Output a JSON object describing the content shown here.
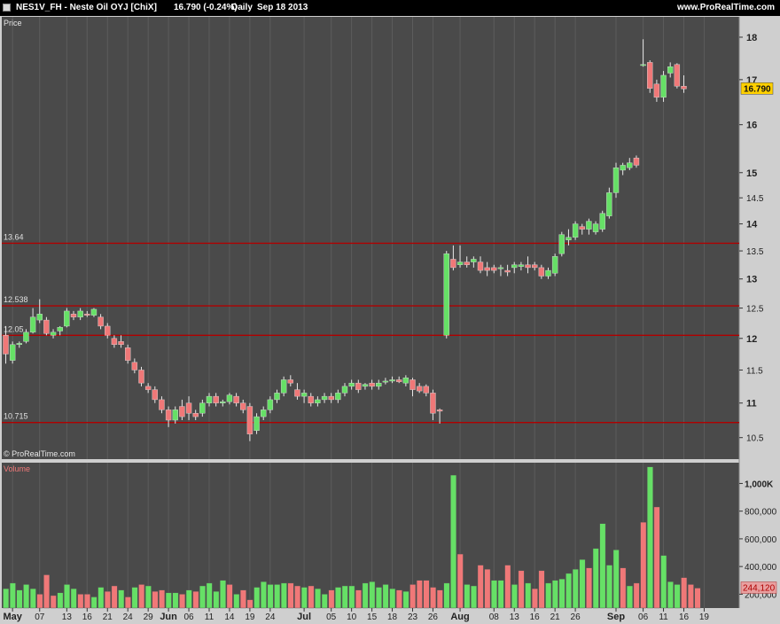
{
  "header": {
    "symbol": "NES1V_FH - Neste Oil OYJ [ChiX]",
    "quote": "16.790 (-0.24%)",
    "period": "Daily",
    "date": "Sep 18 2013",
    "site": "www.ProRealTime.com"
  },
  "colors": {
    "up": "#66e066",
    "down": "#f07878",
    "panel": "#4a4a4a",
    "level_line": "#b00000",
    "last_price_bg": "#ffd000"
  },
  "chart_data": [
    {
      "type": "candlestick",
      "title": "Price",
      "watermark": "© ProRealTime.com",
      "y_scale": "log",
      "ylim": [
        10.2,
        18.5
      ],
      "y_ticks": [
        10.5,
        11,
        11.5,
        12,
        12.5,
        13,
        13.5,
        14,
        14.5,
        15,
        16,
        17,
        18
      ],
      "y_tick_labels": [
        "10.5",
        "11",
        "11.5",
        "12",
        "12.5",
        "13",
        "13.5",
        "14",
        "14.5",
        "15",
        "16",
        "17",
        "18"
      ],
      "last_price_label": "16.790",
      "last_price": 16.79,
      "levels": [
        {
          "value": 13.64,
          "label": "13.64"
        },
        {
          "value": 12.538,
          "label": "12.538"
        },
        {
          "value": 12.05,
          "label": "12.05"
        },
        {
          "value": 10.715,
          "label": "10.715"
        }
      ],
      "x_labels": [
        {
          "label": "May",
          "bar": 1,
          "bold": true
        },
        {
          "label": "07",
          "bar": 5,
          "bold": false
        },
        {
          "label": "13",
          "bar": 9,
          "bold": false
        },
        {
          "label": "16",
          "bar": 12,
          "bold": false
        },
        {
          "label": "21",
          "bar": 15,
          "bold": false
        },
        {
          "label": "24",
          "bar": 18,
          "bold": false
        },
        {
          "label": "29",
          "bar": 21,
          "bold": false
        },
        {
          "label": "Jun",
          "bar": 24,
          "bold": true
        },
        {
          "label": "06",
          "bar": 27,
          "bold": false
        },
        {
          "label": "11",
          "bar": 30,
          "bold": false
        },
        {
          "label": "14",
          "bar": 33,
          "bold": false
        },
        {
          "label": "19",
          "bar": 36,
          "bold": false
        },
        {
          "label": "24",
          "bar": 39,
          "bold": false
        },
        {
          "label": "Jul",
          "bar": 44,
          "bold": true
        },
        {
          "label": "05",
          "bar": 48,
          "bold": false
        },
        {
          "label": "10",
          "bar": 51,
          "bold": false
        },
        {
          "label": "15",
          "bar": 54,
          "bold": false
        },
        {
          "label": "18",
          "bar": 57,
          "bold": false
        },
        {
          "label": "23",
          "bar": 60,
          "bold": false
        },
        {
          "label": "26",
          "bar": 63,
          "bold": false
        },
        {
          "label": "Aug",
          "bar": 67,
          "bold": true
        },
        {
          "label": "08",
          "bar": 72,
          "bold": false
        },
        {
          "label": "13",
          "bar": 75,
          "bold": false
        },
        {
          "label": "16",
          "bar": 78,
          "bold": false
        },
        {
          "label": "21",
          "bar": 81,
          "bold": false
        },
        {
          "label": "26",
          "bar": 84,
          "bold": false
        },
        {
          "label": "Sep",
          "bar": 90,
          "bold": true
        },
        {
          "label": "06",
          "bar": 94,
          "bold": false
        },
        {
          "label": "11",
          "bar": 97,
          "bold": false
        },
        {
          "label": "16",
          "bar": 100,
          "bold": false
        },
        {
          "label": "19",
          "bar": 103,
          "bold": false
        }
      ],
      "candles": [
        {
          "o": 12.05,
          "h": 12.2,
          "l": 11.6,
          "c": 11.75
        },
        {
          "o": 11.65,
          "h": 11.95,
          "l": 11.6,
          "c": 11.9
        },
        {
          "o": 11.9,
          "h": 11.95,
          "l": 11.85,
          "c": 11.92
        },
        {
          "o": 11.95,
          "h": 12.15,
          "l": 11.92,
          "c": 12.1
        },
        {
          "o": 12.1,
          "h": 12.5,
          "l": 12.08,
          "c": 12.35
        },
        {
          "o": 12.3,
          "h": 12.65,
          "l": 12.25,
          "c": 12.4
        },
        {
          "o": 12.3,
          "h": 12.35,
          "l": 12.05,
          "c": 12.08
        },
        {
          "o": 12.05,
          "h": 12.15,
          "l": 12.0,
          "c": 12.1
        },
        {
          "o": 12.12,
          "h": 12.2,
          "l": 12.05,
          "c": 12.18
        },
        {
          "o": 12.2,
          "h": 12.5,
          "l": 12.18,
          "c": 12.45
        },
        {
          "o": 12.4,
          "h": 12.45,
          "l": 12.3,
          "c": 12.35
        },
        {
          "o": 12.35,
          "h": 12.5,
          "l": 12.3,
          "c": 12.45
        },
        {
          "o": 12.4,
          "h": 12.45,
          "l": 12.35,
          "c": 12.38
        },
        {
          "o": 12.38,
          "h": 12.5,
          "l": 12.35,
          "c": 12.48
        },
        {
          "o": 12.35,
          "h": 12.4,
          "l": 12.15,
          "c": 12.2
        },
        {
          "o": 12.2,
          "h": 12.25,
          "l": 12.0,
          "c": 12.05
        },
        {
          "o": 12.0,
          "h": 12.05,
          "l": 11.85,
          "c": 11.9
        },
        {
          "o": 11.95,
          "h": 12.05,
          "l": 11.85,
          "c": 11.9
        },
        {
          "o": 11.85,
          "h": 11.9,
          "l": 11.6,
          "c": 11.65
        },
        {
          "o": 11.62,
          "h": 11.68,
          "l": 11.45,
          "c": 11.5
        },
        {
          "o": 11.5,
          "h": 11.55,
          "l": 11.25,
          "c": 11.3
        },
        {
          "o": 11.25,
          "h": 11.3,
          "l": 11.15,
          "c": 11.2
        },
        {
          "o": 11.2,
          "h": 11.25,
          "l": 11.0,
          "c": 11.05
        },
        {
          "o": 11.05,
          "h": 11.1,
          "l": 10.85,
          "c": 10.9
        },
        {
          "o": 10.9,
          "h": 10.95,
          "l": 10.65,
          "c": 10.75
        },
        {
          "o": 10.75,
          "h": 10.95,
          "l": 10.7,
          "c": 10.9
        },
        {
          "o": 10.95,
          "h": 11.05,
          "l": 10.75,
          "c": 10.8
        },
        {
          "o": 11.0,
          "h": 11.1,
          "l": 10.75,
          "c": 10.85
        },
        {
          "o": 10.85,
          "h": 10.9,
          "l": 10.75,
          "c": 10.8
        },
        {
          "o": 10.85,
          "h": 11.05,
          "l": 10.8,
          "c": 11.0
        },
        {
          "o": 11.0,
          "h": 11.15,
          "l": 10.95,
          "c": 11.1
        },
        {
          "o": 11.1,
          "h": 11.15,
          "l": 10.95,
          "c": 11.0
        },
        {
          "o": 11.0,
          "h": 11.05,
          "l": 10.95,
          "c": 11.02
        },
        {
          "o": 11.02,
          "h": 11.15,
          "l": 10.98,
          "c": 11.12
        },
        {
          "o": 11.1,
          "h": 11.15,
          "l": 10.95,
          "c": 11.0
        },
        {
          "o": 11.0,
          "h": 11.05,
          "l": 10.85,
          "c": 10.9
        },
        {
          "o": 10.95,
          "h": 11.0,
          "l": 10.45,
          "c": 10.55
        },
        {
          "o": 10.6,
          "h": 10.85,
          "l": 10.55,
          "c": 10.8
        },
        {
          "o": 10.8,
          "h": 10.95,
          "l": 10.75,
          "c": 10.9
        },
        {
          "o": 10.9,
          "h": 11.1,
          "l": 10.85,
          "c": 11.05
        },
        {
          "o": 11.05,
          "h": 11.2,
          "l": 11.0,
          "c": 11.15
        },
        {
          "o": 11.15,
          "h": 11.4,
          "l": 11.1,
          "c": 11.35
        },
        {
          "o": 11.35,
          "h": 11.42,
          "l": 11.25,
          "c": 11.3
        },
        {
          "o": 11.2,
          "h": 11.3,
          "l": 11.05,
          "c": 11.1
        },
        {
          "o": 11.1,
          "h": 11.2,
          "l": 11.0,
          "c": 11.15
        },
        {
          "o": 11.1,
          "h": 11.15,
          "l": 10.95,
          "c": 11.0
        },
        {
          "o": 11.0,
          "h": 11.1,
          "l": 10.95,
          "c": 11.05
        },
        {
          "o": 11.05,
          "h": 11.15,
          "l": 11.0,
          "c": 11.1
        },
        {
          "o": 11.1,
          "h": 11.15,
          "l": 11.0,
          "c": 11.05
        },
        {
          "o": 11.05,
          "h": 11.2,
          "l": 11.0,
          "c": 11.15
        },
        {
          "o": 11.15,
          "h": 11.3,
          "l": 11.1,
          "c": 11.25
        },
        {
          "o": 11.25,
          "h": 11.35,
          "l": 11.2,
          "c": 11.3
        },
        {
          "o": 11.3,
          "h": 11.35,
          "l": 11.15,
          "c": 11.2
        },
        {
          "o": 11.25,
          "h": 11.3,
          "l": 11.2,
          "c": 11.28
        },
        {
          "o": 11.3,
          "h": 11.35,
          "l": 11.2,
          "c": 11.25
        },
        {
          "o": 11.25,
          "h": 11.35,
          "l": 11.2,
          "c": 11.3
        },
        {
          "o": 11.32,
          "h": 11.38,
          "l": 11.28,
          "c": 11.33
        },
        {
          "o": 11.33,
          "h": 11.4,
          "l": 11.3,
          "c": 11.35
        },
        {
          "o": 11.35,
          "h": 11.4,
          "l": 11.3,
          "c": 11.32
        },
        {
          "o": 11.3,
          "h": 11.42,
          "l": 11.25,
          "c": 11.38
        },
        {
          "o": 11.35,
          "h": 11.38,
          "l": 11.1,
          "c": 11.2
        },
        {
          "o": 11.25,
          "h": 11.3,
          "l": 11.15,
          "c": 11.18
        },
        {
          "o": 11.25,
          "h": 11.28,
          "l": 11.1,
          "c": 11.15
        },
        {
          "o": 11.15,
          "h": 11.2,
          "l": 10.75,
          "c": 10.85
        },
        {
          "o": 10.9,
          "h": 10.92,
          "l": 10.7,
          "c": 10.88
        },
        {
          "o": 12.05,
          "h": 13.5,
          "l": 12.0,
          "c": 13.45
        },
        {
          "o": 13.35,
          "h": 13.6,
          "l": 13.15,
          "c": 13.2
        },
        {
          "o": 13.25,
          "h": 13.6,
          "l": 13.2,
          "c": 13.3
        },
        {
          "o": 13.3,
          "h": 13.4,
          "l": 13.2,
          "c": 13.25
        },
        {
          "o": 13.3,
          "h": 13.4,
          "l": 13.2,
          "c": 13.35
        },
        {
          "o": 13.3,
          "h": 13.4,
          "l": 13.1,
          "c": 13.15
        },
        {
          "o": 13.2,
          "h": 13.3,
          "l": 13.05,
          "c": 13.15
        },
        {
          "o": 13.2,
          "h": 13.25,
          "l": 13.1,
          "c": 13.15
        },
        {
          "o": 13.18,
          "h": 13.25,
          "l": 13.05,
          "c": 13.2
        },
        {
          "o": 13.15,
          "h": 13.25,
          "l": 13.05,
          "c": 13.12
        },
        {
          "o": 13.2,
          "h": 13.3,
          "l": 13.1,
          "c": 13.25
        },
        {
          "o": 13.22,
          "h": 13.3,
          "l": 13.15,
          "c": 13.25
        },
        {
          "o": 13.25,
          "h": 13.4,
          "l": 13.1,
          "c": 13.2
        },
        {
          "o": 13.25,
          "h": 13.3,
          "l": 13.15,
          "c": 13.2
        },
        {
          "o": 13.2,
          "h": 13.25,
          "l": 13.0,
          "c": 13.05
        },
        {
          "o": 13.05,
          "h": 13.2,
          "l": 13.0,
          "c": 13.15
        },
        {
          "o": 13.1,
          "h": 13.45,
          "l": 13.05,
          "c": 13.4
        },
        {
          "o": 13.45,
          "h": 13.85,
          "l": 13.4,
          "c": 13.8
        },
        {
          "o": 13.7,
          "h": 13.9,
          "l": 13.6,
          "c": 13.75
        },
        {
          "o": 13.75,
          "h": 14.05,
          "l": 13.7,
          "c": 14.0
        },
        {
          "o": 13.95,
          "h": 14.0,
          "l": 13.8,
          "c": 13.9
        },
        {
          "o": 13.9,
          "h": 14.1,
          "l": 13.8,
          "c": 14.05
        },
        {
          "o": 13.85,
          "h": 14.05,
          "l": 13.8,
          "c": 14.0
        },
        {
          "o": 13.9,
          "h": 14.25,
          "l": 13.85,
          "c": 14.2
        },
        {
          "o": 14.15,
          "h": 14.7,
          "l": 14.1,
          "c": 14.6
        },
        {
          "o": 14.6,
          "h": 15.2,
          "l": 14.5,
          "c": 15.1
        },
        {
          "o": 15.05,
          "h": 15.2,
          "l": 14.95,
          "c": 15.15
        },
        {
          "o": 15.1,
          "h": 15.3,
          "l": 15.05,
          "c": 15.2
        },
        {
          "o": 15.3,
          "h": 15.35,
          "l": 15.1,
          "c": 15.15
        },
        {
          "o": 17.35,
          "h": 17.95,
          "l": 17.3,
          "c": 17.35
        },
        {
          "o": 17.4,
          "h": 17.45,
          "l": 16.7,
          "c": 16.8
        },
        {
          "o": 16.9,
          "h": 17.0,
          "l": 16.5,
          "c": 16.6
        },
        {
          "o": 16.6,
          "h": 17.2,
          "l": 16.5,
          "c": 17.1
        },
        {
          "o": 17.15,
          "h": 17.4,
          "l": 17.05,
          "c": 17.3
        },
        {
          "o": 17.35,
          "h": 17.38,
          "l": 16.8,
          "c": 16.85
        },
        {
          "o": 16.85,
          "h": 17.1,
          "l": 16.7,
          "c": 16.79
        }
      ]
    },
    {
      "type": "bar",
      "title": "Volume",
      "ylim": [
        100000,
        1150000
      ],
      "y_ticks": [
        200000,
        400000,
        600000,
        800000,
        1000000
      ],
      "y_tick_labels": [
        "200,000",
        "400,000",
        "600,000",
        "800,000",
        "1,000K"
      ],
      "last_value_label": "244,120",
      "last_value": 244120,
      "values": [
        240000,
        280000,
        230000,
        270000,
        240000,
        200000,
        340000,
        190000,
        210000,
        270000,
        240000,
        200000,
        200000,
        180000,
        250000,
        220000,
        260000,
        230000,
        180000,
        250000,
        270000,
        260000,
        220000,
        230000,
        210000,
        210000,
        200000,
        230000,
        220000,
        260000,
        280000,
        220000,
        300000,
        270000,
        200000,
        230000,
        160000,
        250000,
        290000,
        270000,
        270000,
        280000,
        280000,
        260000,
        250000,
        260000,
        240000,
        200000,
        230000,
        250000,
        260000,
        260000,
        230000,
        280000,
        290000,
        250000,
        270000,
        240000,
        230000,
        220000,
        270000,
        300000,
        300000,
        250000,
        230000,
        280000,
        1060000,
        490000,
        270000,
        260000,
        410000,
        380000,
        300000,
        300000,
        410000,
        270000,
        370000,
        280000,
        240000,
        370000,
        280000,
        300000,
        310000,
        350000,
        380000,
        450000,
        390000,
        530000,
        710000,
        410000,
        520000,
        390000,
        260000,
        280000,
        720000,
        1120000,
        830000,
        480000,
        290000,
        270000,
        320000,
        270000,
        244120
      ],
      "up": [
        true,
        true,
        true,
        true,
        true,
        false,
        false,
        false,
        true,
        true,
        true,
        false,
        false,
        true,
        true,
        false,
        false,
        true,
        false,
        true,
        false,
        true,
        false,
        false,
        true,
        true,
        false,
        true,
        false,
        true,
        true,
        true,
        true,
        false,
        true,
        false,
        false,
        true,
        true,
        true,
        true,
        true,
        false,
        false,
        true,
        false,
        true,
        true,
        false,
        true,
        true,
        true,
        false,
        true,
        true,
        true,
        true,
        true,
        false,
        true,
        false,
        false,
        false,
        false,
        false,
        true,
        true,
        false,
        true,
        true,
        false,
        false,
        true,
        true,
        false,
        true,
        false,
        true,
        false,
        false,
        true,
        true,
        true,
        true,
        true,
        true,
        false,
        true,
        true,
        true,
        true,
        false,
        true,
        false,
        false,
        true,
        false,
        true,
        true,
        true,
        false,
        false,
        false
      ]
    }
  ]
}
